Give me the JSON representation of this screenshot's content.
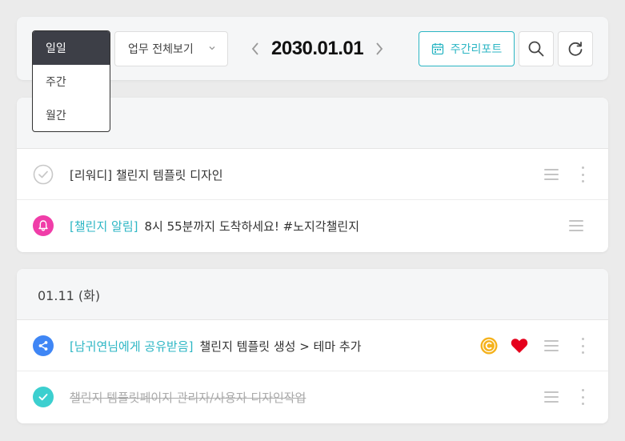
{
  "toolbar": {
    "view_options": [
      "일일",
      "주간",
      "월간"
    ],
    "view_selected": "일일",
    "filter_label": "업무 전체보기",
    "date_title": "2030.01.01",
    "week_report_label": "주간리포트",
    "icons": [
      "calendar-icon",
      "search-icon",
      "refresh-icon",
      "chevron-left-icon",
      "chevron-right-icon",
      "chevron-down-icon"
    ]
  },
  "group1": {
    "header": "",
    "tasks": [
      {
        "tag": "",
        "title": "[리워디] 챌린지 템플릿 디자인",
        "icon": "check-circle-outline-icon"
      },
      {
        "tag": "[챌린지 알림]",
        "title": "8시 55분까지 도착하세요! #노지각챌린지",
        "icon": "bell-icon"
      }
    ]
  },
  "group2": {
    "header": "01.11 (화)",
    "tasks": [
      {
        "tag": "[남귀연님에게 공유받음]",
        "title": "챌린지 템플릿 생성 > 테마 추가",
        "icon": "share-icon",
        "badges": [
          "coin-icon",
          "heart-icon"
        ]
      },
      {
        "tag": "",
        "title": "챌린지 템플릿페이지 관리자/사용자 디자인작업",
        "icon": "check-circle-filled-icon",
        "done": true
      }
    ]
  },
  "colors": {
    "accent": "#2cb6c4",
    "dark": "#3d3f47",
    "bell": "#f03da8",
    "share": "#3f86f5",
    "done": "#3ccfcf",
    "coin": "#f5b21c",
    "heart": "#e5001c",
    "background": "#ebebeb"
  }
}
